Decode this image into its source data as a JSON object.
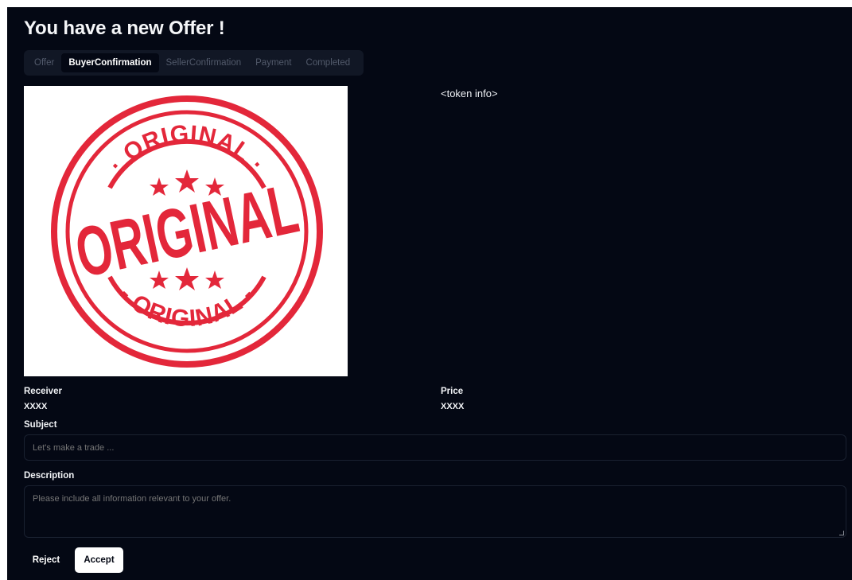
{
  "page": {
    "title": "You have a new Offer !"
  },
  "tabs": [
    {
      "label": "Offer",
      "active": false
    },
    {
      "label": "BuyerConfirmation",
      "active": true
    },
    {
      "label": "SellerConfirmation",
      "active": false
    },
    {
      "label": "Payment",
      "active": false
    },
    {
      "label": "Completed",
      "active": false
    }
  ],
  "token_image": {
    "top_text": "ORIGINAL",
    "center_text": "ORIGINAL",
    "bottom_text": "ORIGINAL",
    "color": "#e3273a"
  },
  "token_info": "<token info>",
  "receiver": {
    "label": "Receiver",
    "value": "XXXX"
  },
  "price": {
    "label": "Price",
    "value": "XXXX"
  },
  "subject": {
    "label": "Subject",
    "placeholder": "Let's make a trade ..."
  },
  "description": {
    "label": "Description",
    "placeholder": "Please include all information relevant to your offer."
  },
  "actions": {
    "reject": "Reject",
    "accept": "Accept"
  }
}
